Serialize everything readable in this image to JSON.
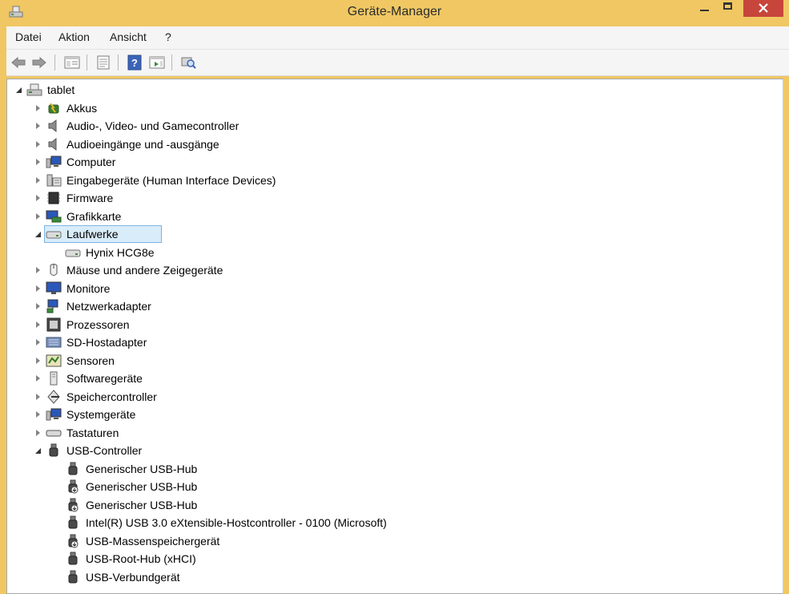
{
  "window": {
    "title": "Geräte-Manager"
  },
  "menu": [
    "Datei",
    "Aktion",
    "Ansicht",
    "?"
  ],
  "toolbar": [
    "back-icon",
    "forward-icon",
    "show-hide-tree-icon",
    "properties-icon",
    "help-icon",
    "action-pane-icon",
    "scan-hardware-icon"
  ],
  "tree": {
    "root": {
      "label": "tablet",
      "icon": "computer-root-icon"
    },
    "categories": [
      {
        "label": "Akkus",
        "icon": "battery-icon",
        "expanded": false
      },
      {
        "label": "Audio-, Video- und Gamecontroller",
        "icon": "speaker-icon",
        "expanded": false
      },
      {
        "label": "Audioeingänge und -ausgänge",
        "icon": "speaker-icon",
        "expanded": false
      },
      {
        "label": "Computer",
        "icon": "computer-icon",
        "expanded": false
      },
      {
        "label": "Eingabegeräte (Human Interface Devices)",
        "icon": "hid-icon",
        "expanded": false
      },
      {
        "label": "Firmware",
        "icon": "firmware-icon",
        "expanded": false
      },
      {
        "label": "Grafikkarte",
        "icon": "display-adapter-icon",
        "expanded": false
      },
      {
        "label": "Laufwerke",
        "icon": "drive-icon",
        "expanded": true,
        "selected": true,
        "children": [
          {
            "label": "Hynix HCG8e",
            "icon": "drive-icon"
          }
        ]
      },
      {
        "label": "Mäuse und andere Zeigegeräte",
        "icon": "mouse-icon",
        "expanded": false
      },
      {
        "label": "Monitore",
        "icon": "monitor-icon",
        "expanded": false
      },
      {
        "label": "Netzwerkadapter",
        "icon": "network-icon",
        "expanded": false
      },
      {
        "label": "Prozessoren",
        "icon": "processor-icon",
        "expanded": false
      },
      {
        "label": "SD-Hostadapter",
        "icon": "sd-host-icon",
        "expanded": false
      },
      {
        "label": "Sensoren",
        "icon": "sensor-icon",
        "expanded": false
      },
      {
        "label": "Softwaregeräte",
        "icon": "software-device-icon",
        "expanded": false
      },
      {
        "label": "Speichercontroller",
        "icon": "storage-controller-icon",
        "expanded": false
      },
      {
        "label": "Systemgeräte",
        "icon": "computer-icon",
        "expanded": false
      },
      {
        "label": "Tastaturen",
        "icon": "keyboard-icon",
        "expanded": false
      },
      {
        "label": "USB-Controller",
        "icon": "usb-icon",
        "expanded": true,
        "children": [
          {
            "label": "Generischer USB-Hub",
            "icon": "usb-icon"
          },
          {
            "label": "Generischer USB-Hub",
            "icon": "usb-hub-icon"
          },
          {
            "label": "Generischer USB-Hub",
            "icon": "usb-hub-icon"
          },
          {
            "label": "Intel(R) USB 3.0 eXtensible-Hostcontroller - 0100 (Microsoft)",
            "icon": "usb-icon"
          },
          {
            "label": "USB-Massenspeichergerät",
            "icon": "usb-hub-icon"
          },
          {
            "label": "USB-Root-Hub (xHCI)",
            "icon": "usb-icon"
          },
          {
            "label": "USB-Verbundgerät",
            "icon": "usb-icon"
          }
        ]
      }
    ]
  },
  "colors": {
    "titlebar": "#f0c763",
    "close": "#c7453b",
    "selection_fill": "#d9ecfa",
    "selection_border": "#7fb4e0"
  }
}
